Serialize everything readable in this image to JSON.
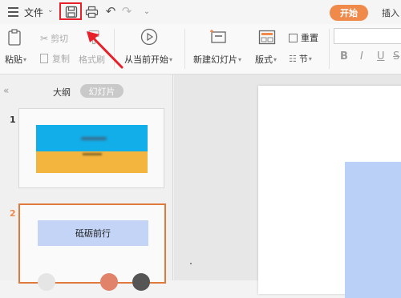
{
  "toolbar": {
    "file_label": "文件",
    "file_caret": "⌄",
    "redo_glyph": "↷",
    "undo_glyph": "↶",
    "quick_access_glyph": "⌄"
  },
  "tabs": {
    "start": "开始",
    "insert": "插入"
  },
  "ribbon": {
    "paste": "粘贴",
    "cut": "剪切",
    "copy": "复制",
    "format_painter": "格式刷",
    "from_current": "从当前开始",
    "new_slide": "新建幻灯片",
    "layout": "版式",
    "reset": "重置",
    "section": "节",
    "bold": "B",
    "italic": "I",
    "underline": "U",
    "strike": "S",
    "dropdown_caret": "▾"
  },
  "left_panel": {
    "collapse_glyph": "«",
    "tab_outline": "大纲",
    "tab_slides": "幻灯片",
    "slides": [
      {
        "number": "1"
      },
      {
        "number": "2",
        "title": "砥砺前行"
      }
    ]
  },
  "colors": {
    "accent": "#f08a4b",
    "highlight_box": "#e8202a",
    "thumb1_top": "#12aee9",
    "thumb1_bottom": "#f3b53e",
    "slide_shape": "#bad0f6"
  }
}
